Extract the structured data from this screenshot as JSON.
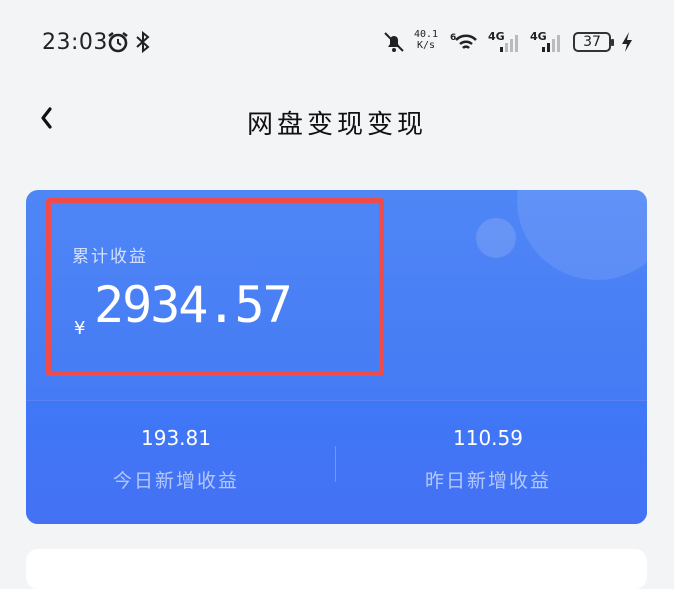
{
  "status_bar": {
    "time": "23:03",
    "net_speed_value": "40.1",
    "net_speed_unit": "K/s",
    "network_1": "4G",
    "network_2": "4G",
    "battery": "37"
  },
  "header": {
    "title": "网盘变现变现",
    "back_icon": "chevron-left-icon"
  },
  "earnings": {
    "total_label": "累计收益",
    "currency_symbol": "¥",
    "total_amount": "2934.57",
    "today": {
      "value": "193.81",
      "label": "今日新增收益"
    },
    "yesterday": {
      "value": "110.59",
      "label": "昨日新增收益"
    }
  },
  "colors": {
    "card_blue": "#4a7ff5",
    "highlight_red": "#ef4b4b",
    "background": "#f3f4f6"
  }
}
